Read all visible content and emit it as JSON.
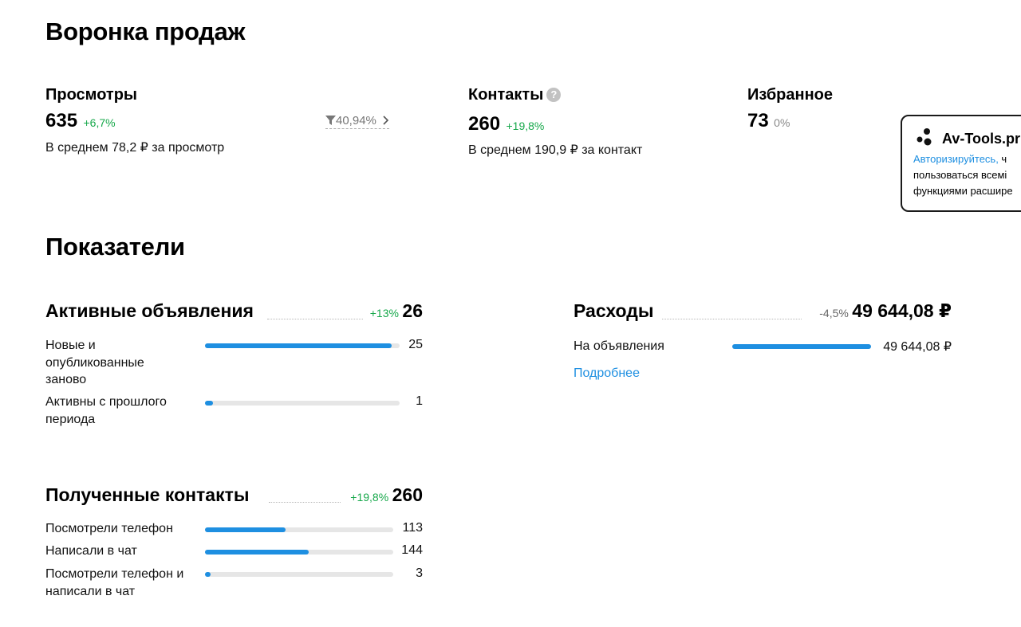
{
  "funnel": {
    "title": "Воронка продаж",
    "views": {
      "label": "Просмотры",
      "value": "635",
      "delta": "+6,7%",
      "avg": "В среднем 78,2 ₽ за просмотр",
      "conversion": "40,94%"
    },
    "contacts": {
      "label": "Контакты",
      "value": "260",
      "delta": "+19,8%",
      "avg": "В среднем 190,9 ₽ за контакт",
      "help": "?"
    },
    "favorites": {
      "label": "Избранное",
      "value": "73",
      "delta": "0%"
    }
  },
  "indicators": {
    "title": "Показатели",
    "active_ads": {
      "title": "Активные объявления",
      "delta": "+13%",
      "total": "26",
      "rows": [
        {
          "label": "Новые и опубликованные заново",
          "value": "25",
          "fraction": 0.96
        },
        {
          "label": "Активны с прошлого периода",
          "value": "1",
          "fraction": 0.04
        }
      ]
    },
    "received_contacts": {
      "title": "Полученные контакты",
      "delta": "+19,8%",
      "total": "260",
      "rows": [
        {
          "label": "Посмотрели телефон",
          "value": "113",
          "fraction": 0.43
        },
        {
          "label": "Написали в чат",
          "value": "144",
          "fraction": 0.55
        },
        {
          "label": "Посмотрели телефон и написали в чат",
          "value": "3",
          "fraction": 0.03
        }
      ]
    },
    "expenses": {
      "title": "Расходы",
      "delta": "-4,5%",
      "total": "49 644,08 ₽",
      "rows": [
        {
          "label": "На объявления",
          "value": "49 644,08 ₽",
          "fraction": 1.0
        }
      ],
      "more_link": "Подробнее"
    }
  },
  "popup": {
    "brand": "Av-Tools.pr",
    "link_text": "Авторизируйтесь,",
    "text_tail": " ч",
    "line2": "пользоваться всемі",
    "line3": "функциями расшире"
  },
  "colors": {
    "accent": "#1e8fe1",
    "positive": "#17a84b",
    "track": "#e6e6e6"
  },
  "icons": [
    "help-icon",
    "filter-icon",
    "chevron-right-icon",
    "av-tools-logo-icon"
  ]
}
